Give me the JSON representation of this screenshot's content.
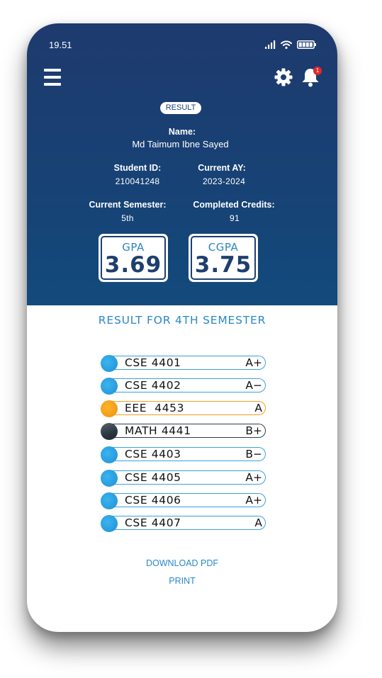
{
  "status_bar": {
    "time": "19.51"
  },
  "header": {
    "badge_count": "1",
    "result_pill": "RESULT",
    "name_label": "Name:",
    "name_value": "Md Taimum Ibne Sayed",
    "student_id_label": "Student ID:",
    "student_id_value": "210041248",
    "current_ay_label": "Current AY:",
    "current_ay_value": "2023-2024",
    "current_semester_label": "Current Semester:",
    "current_semester_value": "5th",
    "completed_credits_label": "Completed Credits:",
    "completed_credits_value": "91",
    "gpa_label": "GPA",
    "gpa_value": "3.69",
    "cgpa_label": "CGPA",
    "cgpa_value": "3.75"
  },
  "semester_title": "RESULT FOR 4TH SEMESTER",
  "courses": [
    {
      "code": "CSE 4401",
      "grade": "A+",
      "color": "#2aa3e4"
    },
    {
      "code": "CSE 4402",
      "grade": "A−",
      "color": "#2aa3e4"
    },
    {
      "code": "EEE  4453",
      "grade": "A",
      "color": "#f5a01a"
    },
    {
      "code": "MATH 4441",
      "grade": "B+",
      "color": "#2f3d48"
    },
    {
      "code": "CSE 4403",
      "grade": "B−",
      "color": "#2aa3e4"
    },
    {
      "code": "CSE 4405",
      "grade": "A+",
      "color": "#2aa3e4"
    },
    {
      "code": "CSE 4406",
      "grade": "A+",
      "color": "#2aa3e4"
    },
    {
      "code": "CSE 4407",
      "grade": "A",
      "color": "#2aa3e4"
    }
  ],
  "actions": {
    "download_pdf": "DOWNLOAD PDF",
    "print": "PRINT"
  },
  "colors": {
    "header_bg": "#1a4373",
    "accent": "#2a88c8",
    "badge": "#e02a2a"
  },
  "icons": [
    "menu-icon",
    "gear-icon",
    "bell-icon",
    "signal-icon",
    "wifi-icon",
    "battery-icon"
  ]
}
